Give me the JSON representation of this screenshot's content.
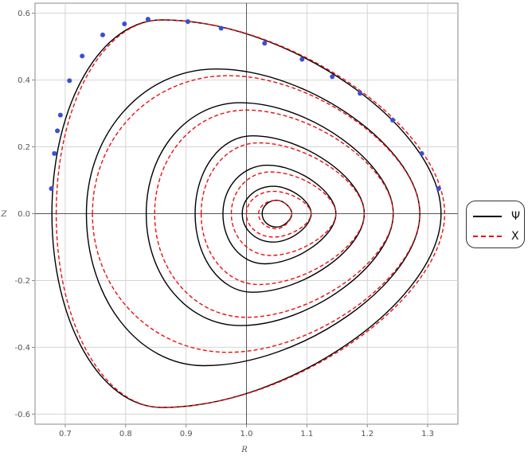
{
  "chart_data": {
    "type": "line",
    "title": "",
    "xlabel": "R",
    "ylabel": "Z",
    "xlim": [
      0.65,
      1.35
    ],
    "ylim": [
      -0.63,
      0.63
    ],
    "grid": true,
    "legend_placement": "right",
    "x_ticks": [
      "0.7",
      "0.8",
      "0.9",
      "1.0",
      "1.1",
      "1.2",
      "1.3"
    ],
    "y_ticks": [
      "-0.6",
      "-0.4",
      "-0.2",
      "0.0",
      "0.2",
      "0.4",
      "0.6"
    ],
    "colors": {
      "psi": "#000000",
      "chi": "#e81010",
      "points": "#3a4fd0"
    },
    "series": [
      {
        "name": "Ψ",
        "style": "solid",
        "contours": [
          {
            "r_min": 0.678,
            "r_max": 1.322,
            "z_top": 0.58,
            "z_bottom": -0.58,
            "r_top": 0.86,
            "r_bottom": 0.86
          },
          {
            "r_min": 0.735,
            "r_max": 1.287,
            "z_top": 0.433,
            "z_bottom": -0.455,
            "r_top": 0.95,
            "r_bottom": 0.93
          },
          {
            "r_min": 0.834,
            "r_max": 1.243,
            "z_top": 0.332,
            "z_bottom": -0.335,
            "r_top": 0.99,
            "r_bottom": 0.99
          },
          {
            "r_min": 0.915,
            "r_max": 1.195,
            "z_top": 0.233,
            "z_bottom": -0.235,
            "r_top": 1.01,
            "r_bottom": 1.01
          },
          {
            "r_min": 0.961,
            "r_max": 1.148,
            "z_top": 0.145,
            "z_bottom": -0.15,
            "r_top": 1.035,
            "r_bottom": 1.03
          },
          {
            "r_min": 0.993,
            "r_max": 1.107,
            "z_top": 0.082,
            "z_bottom": -0.085,
            "r_top": 1.045,
            "r_bottom": 1.045
          },
          {
            "r_min": 1.026,
            "r_max": 1.075,
            "z_top": 0.04,
            "z_bottom": -0.04,
            "r_top": 1.05,
            "r_bottom": 1.05
          }
        ]
      },
      {
        "name": "X",
        "style": "dashed",
        "contours": [
          {
            "r_min": 0.685,
            "r_max": 1.328,
            "z_top": 0.58,
            "z_bottom": -0.58,
            "r_top": 0.86,
            "r_bottom": 0.86
          },
          {
            "r_min": 0.745,
            "r_max": 1.287,
            "z_top": 0.413,
            "z_bottom": -0.415,
            "r_top": 0.97,
            "r_bottom": 0.97
          },
          {
            "r_min": 0.848,
            "r_max": 1.243,
            "z_top": 0.31,
            "z_bottom": -0.31,
            "r_top": 1.0,
            "r_bottom": 1.0
          },
          {
            "r_min": 0.925,
            "r_max": 1.195,
            "z_top": 0.212,
            "z_bottom": -0.212,
            "r_top": 1.02,
            "r_bottom": 1.02
          },
          {
            "r_min": 0.975,
            "r_max": 1.148,
            "z_top": 0.125,
            "z_bottom": -0.125,
            "r_top": 1.04,
            "r_bottom": 1.04
          },
          {
            "r_min": 1.0,
            "r_max": 1.107,
            "z_top": 0.067,
            "z_bottom": -0.07,
            "r_top": 1.045,
            "r_bottom": 1.045
          },
          {
            "r_min": 1.02,
            "r_max": 1.075,
            "z_top": 0.04,
            "z_bottom": -0.045,
            "r_top": 1.05,
            "r_bottom": 1.05
          }
        ]
      }
    ],
    "points": [
      {
        "r": 0.677,
        "z": 0.075
      },
      {
        "r": 0.682,
        "z": 0.18
      },
      {
        "r": 0.687,
        "z": 0.248
      },
      {
        "r": 0.692,
        "z": 0.295
      },
      {
        "r": 0.707,
        "z": 0.398
      },
      {
        "r": 0.728,
        "z": 0.472
      },
      {
        "r": 0.762,
        "z": 0.535
      },
      {
        "r": 0.798,
        "z": 0.568
      },
      {
        "r": 0.837,
        "z": 0.582
      },
      {
        "r": 0.903,
        "z": 0.575
      },
      {
        "r": 0.958,
        "z": 0.555
      },
      {
        "r": 1.03,
        "z": 0.51
      },
      {
        "r": 1.092,
        "z": 0.462
      },
      {
        "r": 1.142,
        "z": 0.41
      },
      {
        "r": 1.188,
        "z": 0.36
      },
      {
        "r": 1.242,
        "z": 0.28
      },
      {
        "r": 1.29,
        "z": 0.18
      },
      {
        "r": 1.318,
        "z": 0.075
      }
    ]
  }
}
